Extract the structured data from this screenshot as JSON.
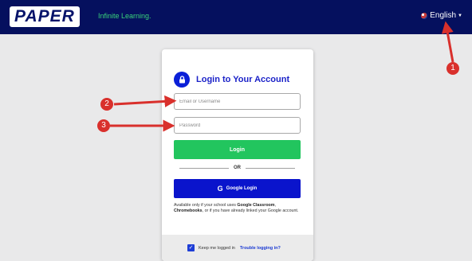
{
  "header": {
    "logo": "PAPER",
    "tagline": "Infinite Learning.",
    "language": "English"
  },
  "login": {
    "title": "Login to Your Account",
    "email_placeholder": "Email or Username",
    "password_placeholder": "Password",
    "login_label": "Login",
    "or_label": "OR",
    "google_label": "Google Login",
    "note_part1": "Available only if your school uses ",
    "note_bold1": "Google Classroom",
    "note_part2": ", ",
    "note_bold2": "Chromebooks",
    "note_part3": ", or if you have already linked your Google account.",
    "keep_logged_in": "Keep me logged in",
    "trouble_link": "Trouble logging in?"
  },
  "annotations": {
    "badge1": "1",
    "badge2": "2",
    "badge3": "3",
    "color": "#d9302c"
  },
  "colors": {
    "header_bg": "#05105e",
    "tagline": "#39d27a",
    "login_button": "#22c55e",
    "google_button": "#0a14cc"
  }
}
